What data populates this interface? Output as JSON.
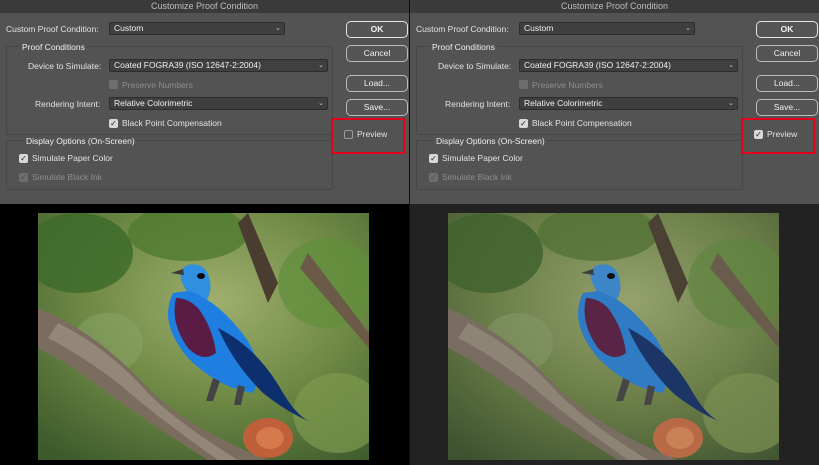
{
  "panels": [
    {
      "window_title": "Customize Proof Condition",
      "custom_proof_condition_label": "Custom Proof Condition:",
      "custom_proof_condition_value": "Custom",
      "proof_conditions_heading": "Proof Conditions",
      "device_to_simulate_label": "Device to Simulate:",
      "device_to_simulate_value": "Coated FOGRA39 (ISO 12647-2:2004)",
      "preserve_numbers_label": "Preserve Numbers",
      "rendering_intent_label": "Rendering Intent:",
      "rendering_intent_value": "Relative Colorimetric",
      "black_point_label": "Black Point Compensation",
      "display_options_heading": "Display Options (On-Screen)",
      "simulate_paper_label": "Simulate Paper Color",
      "simulate_ink_label": "Simulate Black Ink",
      "buttons": {
        "ok": "OK",
        "cancel": "Cancel",
        "load": "Load...",
        "save": "Save..."
      },
      "preview_label": "Preview",
      "preview_checked": false,
      "black_point_checked": true,
      "simulate_paper_checked": true
    },
    {
      "window_title": "Customize Proof Condition",
      "custom_proof_condition_label": "Custom Proof Condition:",
      "custom_proof_condition_value": "Custom",
      "proof_conditions_heading": "Proof Conditions",
      "device_to_simulate_label": "Device to Simulate:",
      "device_to_simulate_value": "Coated FOGRA39 (ISO 12647-2:2004)",
      "preserve_numbers_label": "Preserve Numbers",
      "rendering_intent_label": "Rendering Intent:",
      "rendering_intent_value": "Relative Colorimetric",
      "black_point_label": "Black Point Compensation",
      "display_options_heading": "Display Options (On-Screen)",
      "simulate_paper_label": "Simulate Paper Color",
      "simulate_ink_label": "Simulate Black Ink",
      "buttons": {
        "ok": "OK",
        "cancel": "Cancel",
        "load": "Load...",
        "save": "Save..."
      },
      "preview_label": "Preview",
      "preview_checked": true,
      "black_point_checked": true,
      "simulate_paper_checked": true
    }
  ],
  "highlight_color": "#e2001a",
  "photo_subject": "blue cotinga bird perched on a mossy branch"
}
